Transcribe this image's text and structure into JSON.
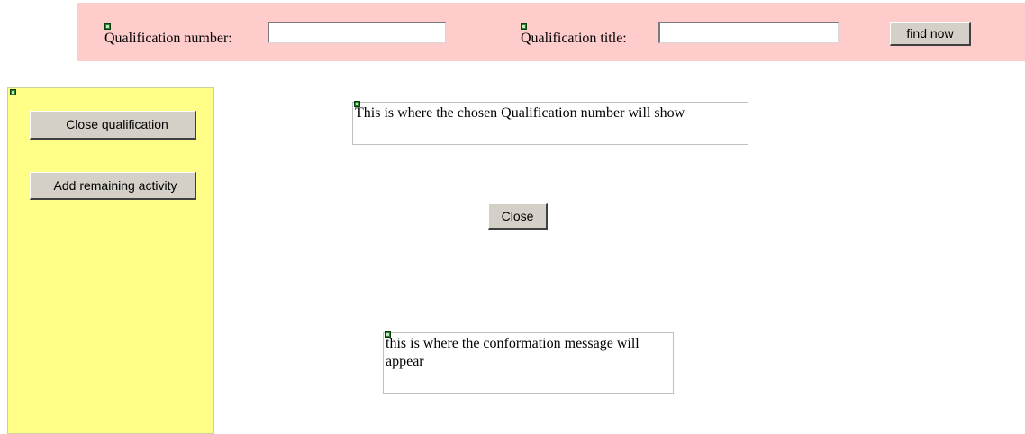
{
  "search": {
    "qualification_number_label": "Qualification number:",
    "qualification_number_value": "",
    "qualification_title_label": "Qualification title:",
    "qualification_title_value": "",
    "find_button_label": "find now"
  },
  "sidebar": {
    "close_qualification_label": "Close qualification",
    "add_remaining_activity_label": "Add remaining activity"
  },
  "main": {
    "qualification_display_text": "This is where the chosen Qualification number will show",
    "close_button_label": "Close",
    "confirmation_text": "this is where the conformation message will appear"
  },
  "colors": {
    "search_bar_bg": "#ffcccc",
    "sidebar_bg": "#ffff88",
    "button_face": "#d4d0c8"
  }
}
